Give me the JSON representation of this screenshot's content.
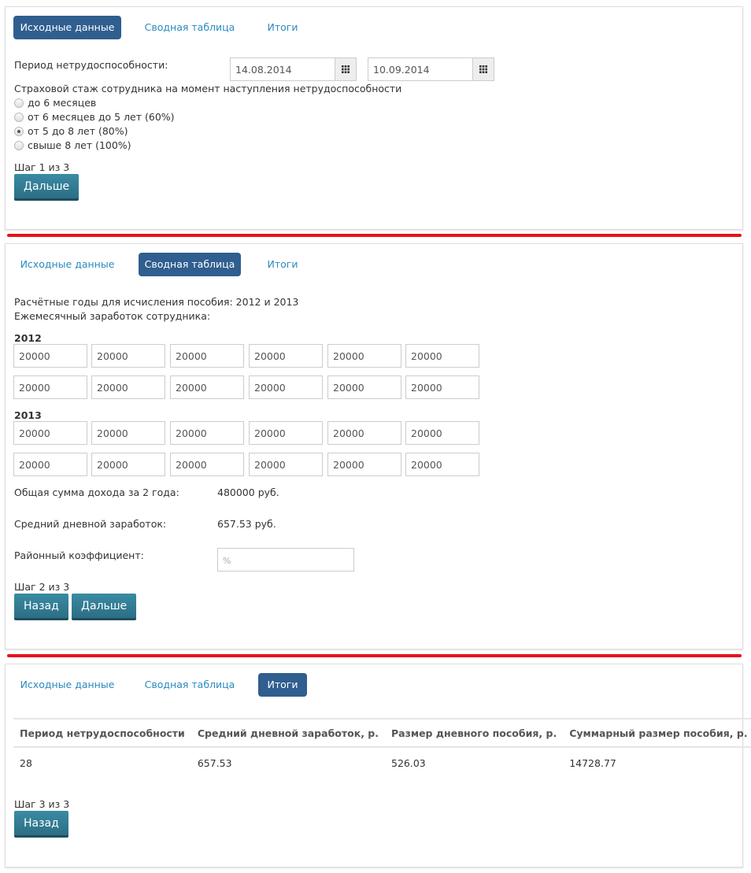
{
  "tabs": [
    "Исходные данные",
    "Сводная таблица",
    "Итоги"
  ],
  "step1": {
    "period_label": "Период нетрудоспособности:",
    "date_from": "14.08.2014",
    "date_to": "10.09.2014",
    "insurance_label": "Страховой стаж сотрудника на момент наступления нетрудоспособности",
    "options": [
      "до 6 месяцев",
      "от 6 месяцев до 5 лет (60%)",
      "от 5 до 8 лет (80%)",
      "свыше 8 лет (100%)"
    ],
    "selected_option": "от 5 до 8 лет (80%)",
    "step_text": "Шаг 1 из 3",
    "next_label": "Дальше"
  },
  "step2": {
    "years_text": "Расчётные годы для исчисления пособия: 2012 и 2013",
    "monthly_label": "Ежемесячный заработок сотрудника:",
    "year1": "2012",
    "year2": "2013",
    "year1_values": [
      "20000",
      "20000",
      "20000",
      "20000",
      "20000",
      "20000",
      "20000",
      "20000",
      "20000",
      "20000",
      "20000",
      "20000"
    ],
    "year2_values": [
      "20000",
      "20000",
      "20000",
      "20000",
      "20000",
      "20000",
      "20000",
      "20000",
      "20000",
      "20000",
      "20000",
      "20000"
    ],
    "total_label": "Общая сумма дохода за 2 года:",
    "total_value": "480000 руб.",
    "avg_label": "Средний дневной заработок:",
    "avg_value": "657.53 руб.",
    "coef_label": "Районный коэффициент:",
    "coef_placeholder": "%",
    "step_text": "Шаг 2 из 3",
    "back_label": "Назад",
    "next_label": "Дальше"
  },
  "step3": {
    "columns": [
      "Период нетрудоспособности",
      "Средний дневной заработок, р.",
      "Размер дневного пособия, р.",
      "Суммарный размер пособия, р."
    ],
    "row": [
      "28",
      "657.53",
      "526.03",
      "14728.77"
    ],
    "step_text": "Шаг 3 из 3",
    "back_label": "Назад"
  },
  "colors": {
    "accent": "#2f5e8f",
    "link": "#2a8bc0",
    "button": "#2c6e85",
    "divider": "#e8101a"
  }
}
